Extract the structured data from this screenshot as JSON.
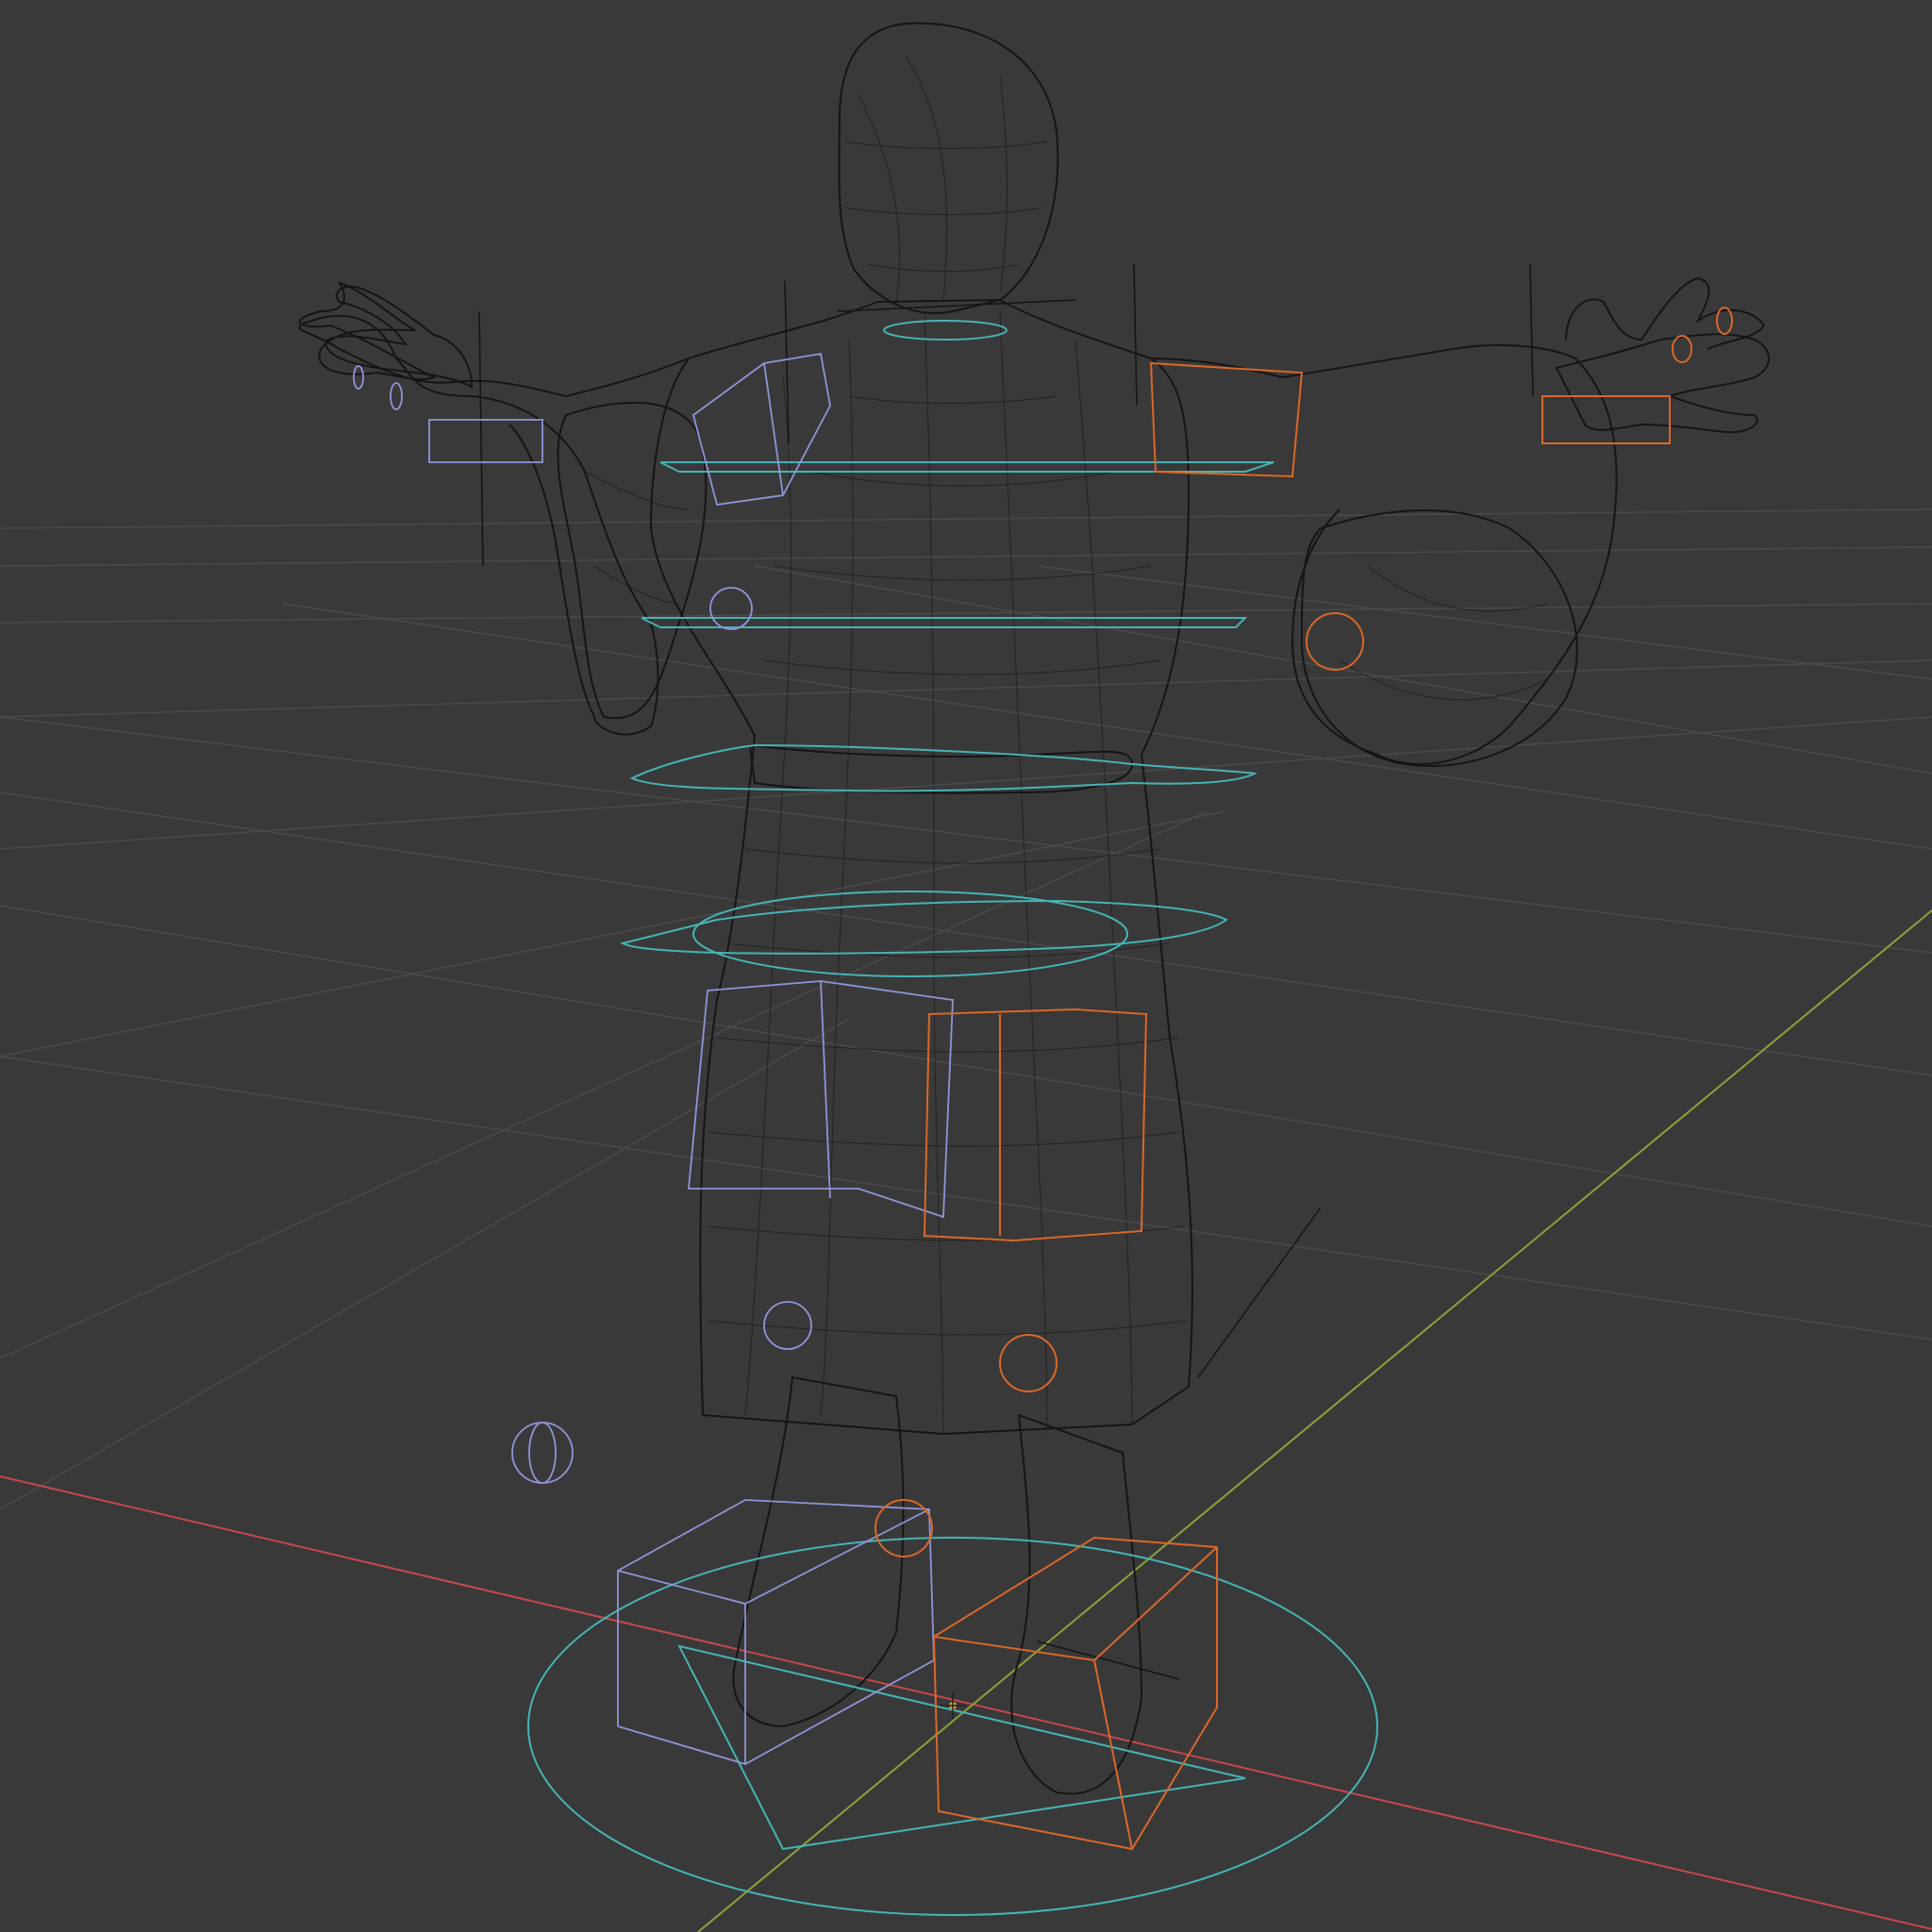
{
  "viewport": {
    "mode": "wireframe",
    "background": "#393939",
    "grid_color": "#4a4a4a",
    "x_axis_color": "#c8474d",
    "y_axis_color": "#8ba23a",
    "mesh_color": "#151515",
    "control_colors": {
      "center": "#46b3b3",
      "left": "#8f94d8",
      "right": "#d9682a"
    }
  },
  "scene_objects": [
    {
      "name": "character-mesh",
      "type": "mesh"
    },
    {
      "name": "rig-root-circle",
      "type": "control",
      "side": "center"
    },
    {
      "name": "torso-rings",
      "type": "control",
      "side": "center"
    },
    {
      "name": "left-arm-controls",
      "type": "control",
      "side": "left"
    },
    {
      "name": "right-arm-controls",
      "type": "control",
      "side": "right"
    },
    {
      "name": "left-leg-controls",
      "type": "control",
      "side": "left"
    },
    {
      "name": "right-leg-controls",
      "type": "control",
      "side": "right"
    },
    {
      "name": "world-origin",
      "type": "empty"
    }
  ]
}
